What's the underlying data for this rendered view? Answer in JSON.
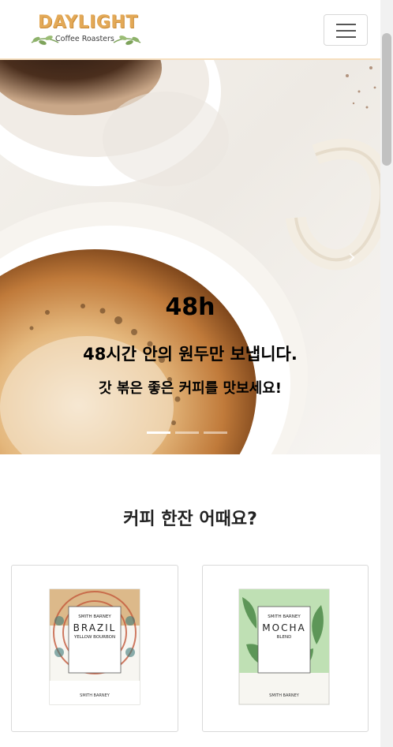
{
  "brand": {
    "name": "DAYLIGHT",
    "tagline": "Coffee Roasters",
    "accent": "#e3a957"
  },
  "nav": {
    "toggler_icon": "hamburger-icon"
  },
  "carousel": {
    "prev_icon": "chevron-left-icon",
    "next_icon": "chevron-right-icon",
    "prev_glyph": "‹",
    "next_glyph": "›",
    "heading": "48h",
    "line1": "48시간 안의 원두만 보냅니다.",
    "line2": "갓 볶은 좋은 커피를 맛보세요!",
    "slide_count": 3,
    "active_slide": 1
  },
  "section": {
    "title": "커피 한잔 어때요?"
  },
  "products": [
    {
      "maker": "SMITH BARNEY",
      "origin": "BRAZIL",
      "variety": "YELLOW BOURBON",
      "pattern_color": "#c45a3c"
    },
    {
      "maker": "SMITH BARNEY",
      "origin": "MOCHA",
      "variety": "BLEND",
      "pattern_color": "#4d8a48"
    }
  ]
}
